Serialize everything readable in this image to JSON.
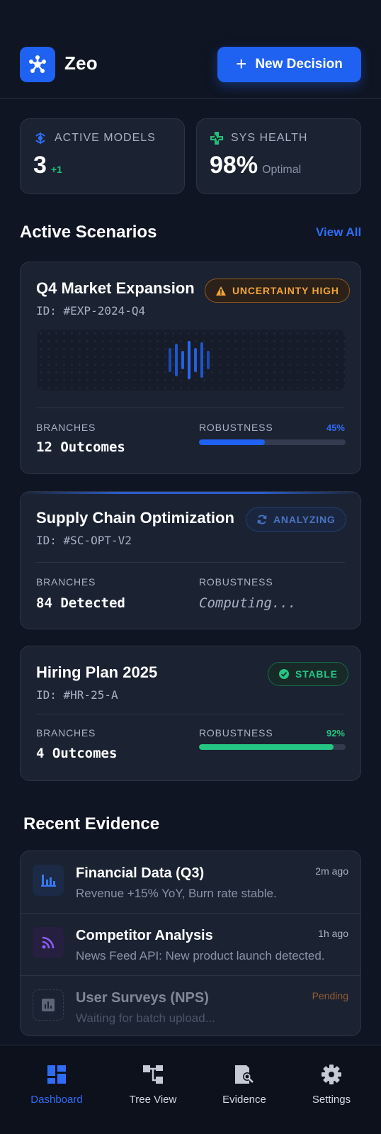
{
  "app": {
    "title": "Zeo",
    "new_decision_label": "New Decision"
  },
  "stats": {
    "models": {
      "label": "ACTIVE MODELS",
      "value": "3",
      "delta": "+1"
    },
    "health": {
      "label": "SYS HEALTH",
      "value": "98%",
      "status": "Optimal"
    }
  },
  "scenarios_section": {
    "title": "Active Scenarios",
    "view_all": "View All"
  },
  "scenarios": [
    {
      "name": "Q4 Market Expansion",
      "id": "ID: #EXP-2024-Q4",
      "badge": "UNCERTAINTY HIGH",
      "branches_label": "BRANCHES",
      "branches_value": "12 Outcomes",
      "robustness_label": "ROBUSTNESS",
      "robustness_pct": "45%",
      "robustness": 0.45
    },
    {
      "name": "Supply Chain Optimization",
      "id": "ID: #SC-OPT-V2",
      "badge": "ANALYZING",
      "branches_label": "BRANCHES",
      "branches_value": "84 Detected",
      "robustness_label": "ROBUSTNESS",
      "robustness_status": "Computing..."
    },
    {
      "name": "Hiring Plan 2025",
      "id": "ID: #HR-25-A",
      "badge": "STABLE",
      "branches_label": "BRANCHES",
      "branches_value": "4 Outcomes",
      "robustness_label": "ROBUSTNESS",
      "robustness_pct": "92%",
      "robustness": 0.92
    }
  ],
  "evidence_section": {
    "title": "Recent Evidence"
  },
  "evidence": [
    {
      "title": "Financial Data (Q3)",
      "desc": "Revenue +15% YoY, Burn rate stable.",
      "time": "2m ago",
      "icon": "bar-chart-icon"
    },
    {
      "title": "Competitor Analysis",
      "desc": "News Feed API: New product launch detected.",
      "time": "1h ago",
      "icon": "rss-feed-icon"
    },
    {
      "title": "User Surveys (NPS)",
      "desc": "Waiting for batch upload...",
      "time": "Pending",
      "icon": "survey-chart-icon"
    }
  ],
  "nav": [
    {
      "label": "Dashboard",
      "icon": "dashboard-icon",
      "active": true
    },
    {
      "label": "Tree View",
      "icon": "tree-view-icon",
      "active": false
    },
    {
      "label": "Evidence",
      "icon": "evidence-icon",
      "active": false
    },
    {
      "label": "Settings",
      "icon": "gear-icon",
      "active": false
    }
  ],
  "colors": {
    "accent": "#1f62f2",
    "warning": "#f2a43a",
    "success": "#25c583",
    "background": "#0f1522",
    "card": "#1b2232"
  }
}
